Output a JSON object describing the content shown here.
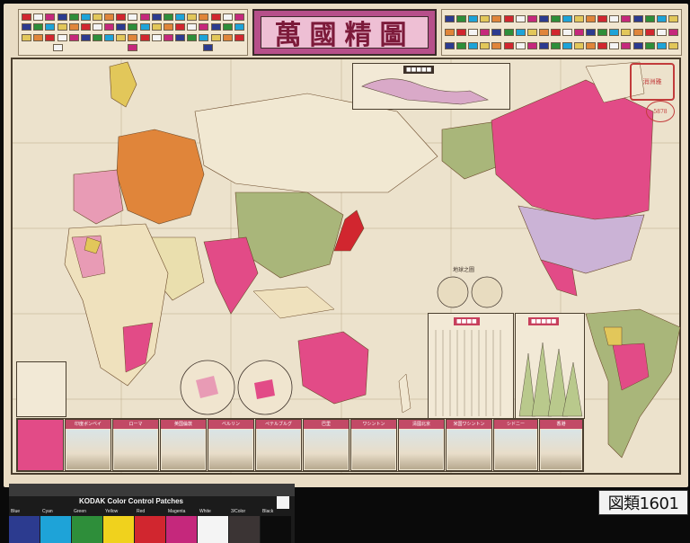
{
  "map": {
    "title": "萬國精圖",
    "stamp_text": "消洲雅",
    "stamp_number": "5878",
    "hemisphere_title": "地球之圖"
  },
  "bottom_strip": {
    "panels": [
      {
        "label": "印度ボンベイ"
      },
      {
        "label": "ローマ"
      },
      {
        "label": "英国倫敦"
      },
      {
        "label": "ベルリン"
      },
      {
        "label": "ペテルブルグ"
      },
      {
        "label": "巴里"
      },
      {
        "label": "ワシントン"
      },
      {
        "label": "清國北京"
      },
      {
        "label": "米国ワシントン"
      },
      {
        "label": "シドニー"
      },
      {
        "label": "香港"
      }
    ]
  },
  "color_card": {
    "title": "KODAK Color Control Patches",
    "patches": [
      {
        "label": "Blue",
        "color": "#2c3b8f"
      },
      {
        "label": "Cyan",
        "color": "#1ea3d8"
      },
      {
        "label": "Green",
        "color": "#2e8e3a"
      },
      {
        "label": "Yellow",
        "color": "#f0d21d"
      },
      {
        "label": "Red",
        "color": "#d1262f"
      },
      {
        "label": "Magenta",
        "color": "#c5287c"
      },
      {
        "label": "White",
        "color": "#f4f4f4"
      },
      {
        "label": "3/Color",
        "color": "#3b3434"
      },
      {
        "label": "Black",
        "color": "#0c0c0c"
      }
    ]
  },
  "catalog_label": "図類1601",
  "colors": {
    "paper": "#e9dcc4",
    "pink": "#e24b87",
    "orange": "#e0853a",
    "green": "#a9b67a",
    "yellow": "#e2c75a",
    "magenta": "#c73f5c"
  }
}
